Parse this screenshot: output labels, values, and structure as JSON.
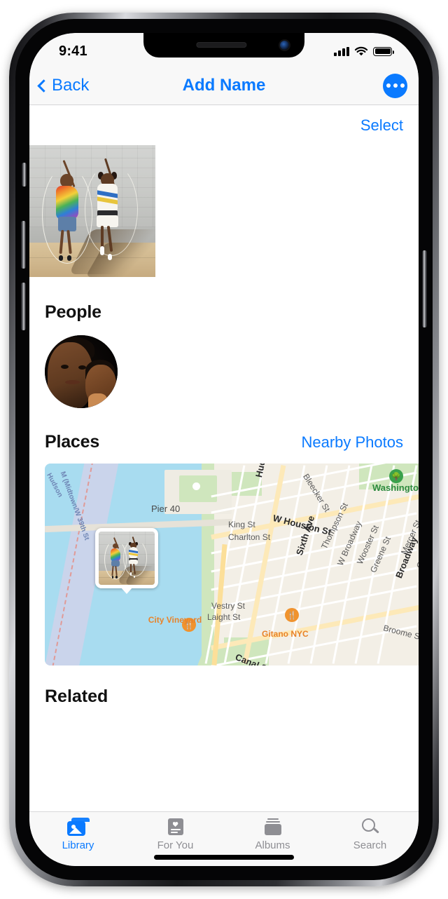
{
  "status_bar": {
    "time": "9:41",
    "signal_icon": "cellular-bars-icon",
    "wifi_icon": "wifi-icon",
    "battery_icon": "battery-full-icon"
  },
  "nav_bar": {
    "back_label": "Back",
    "title": "Add Name",
    "more_icon": "ellipsis-icon",
    "accent_color": "#0a7aff"
  },
  "toolbar": {
    "select_label": "Select"
  },
  "hero": {
    "photo_alt": "two-girls-jumping-rope-photo"
  },
  "people": {
    "title": "People",
    "person_alt": "person-face-thumbnail"
  },
  "places": {
    "title": "Places",
    "nearby_link": "Nearby Photos",
    "map": {
      "water_label": "Hudson",
      "ferry_route": "M (Midtown/W 39th St",
      "pier_label": "Pier 40",
      "city_vineyard": "City Vineyard",
      "gitano": "Gitano NYC",
      "washington_square": "Washington Square",
      "streets": [
        "Hudson St",
        "Bleecker St",
        "W Houston St",
        "King St",
        "Charlton St",
        "Sixth Ave",
        "Thompson St",
        "W Broadway",
        "Wooster St",
        "Greene St",
        "Mercer St",
        "Broadway",
        "Crosby St",
        "Canal St",
        "Broome St",
        "Vestry St",
        "Laight St"
      ],
      "photo_pin_alt": "map-photo-callout"
    }
  },
  "related": {
    "title": "Related"
  },
  "tab_bar": {
    "items": [
      {
        "label": "Library",
        "icon": "photos-library-icon",
        "active": true
      },
      {
        "label": "For You",
        "icon": "for-you-heart-icon",
        "active": false
      },
      {
        "label": "Albums",
        "icon": "albums-stack-icon",
        "active": false
      },
      {
        "label": "Search",
        "icon": "magnifier-icon",
        "active": false
      }
    ]
  }
}
